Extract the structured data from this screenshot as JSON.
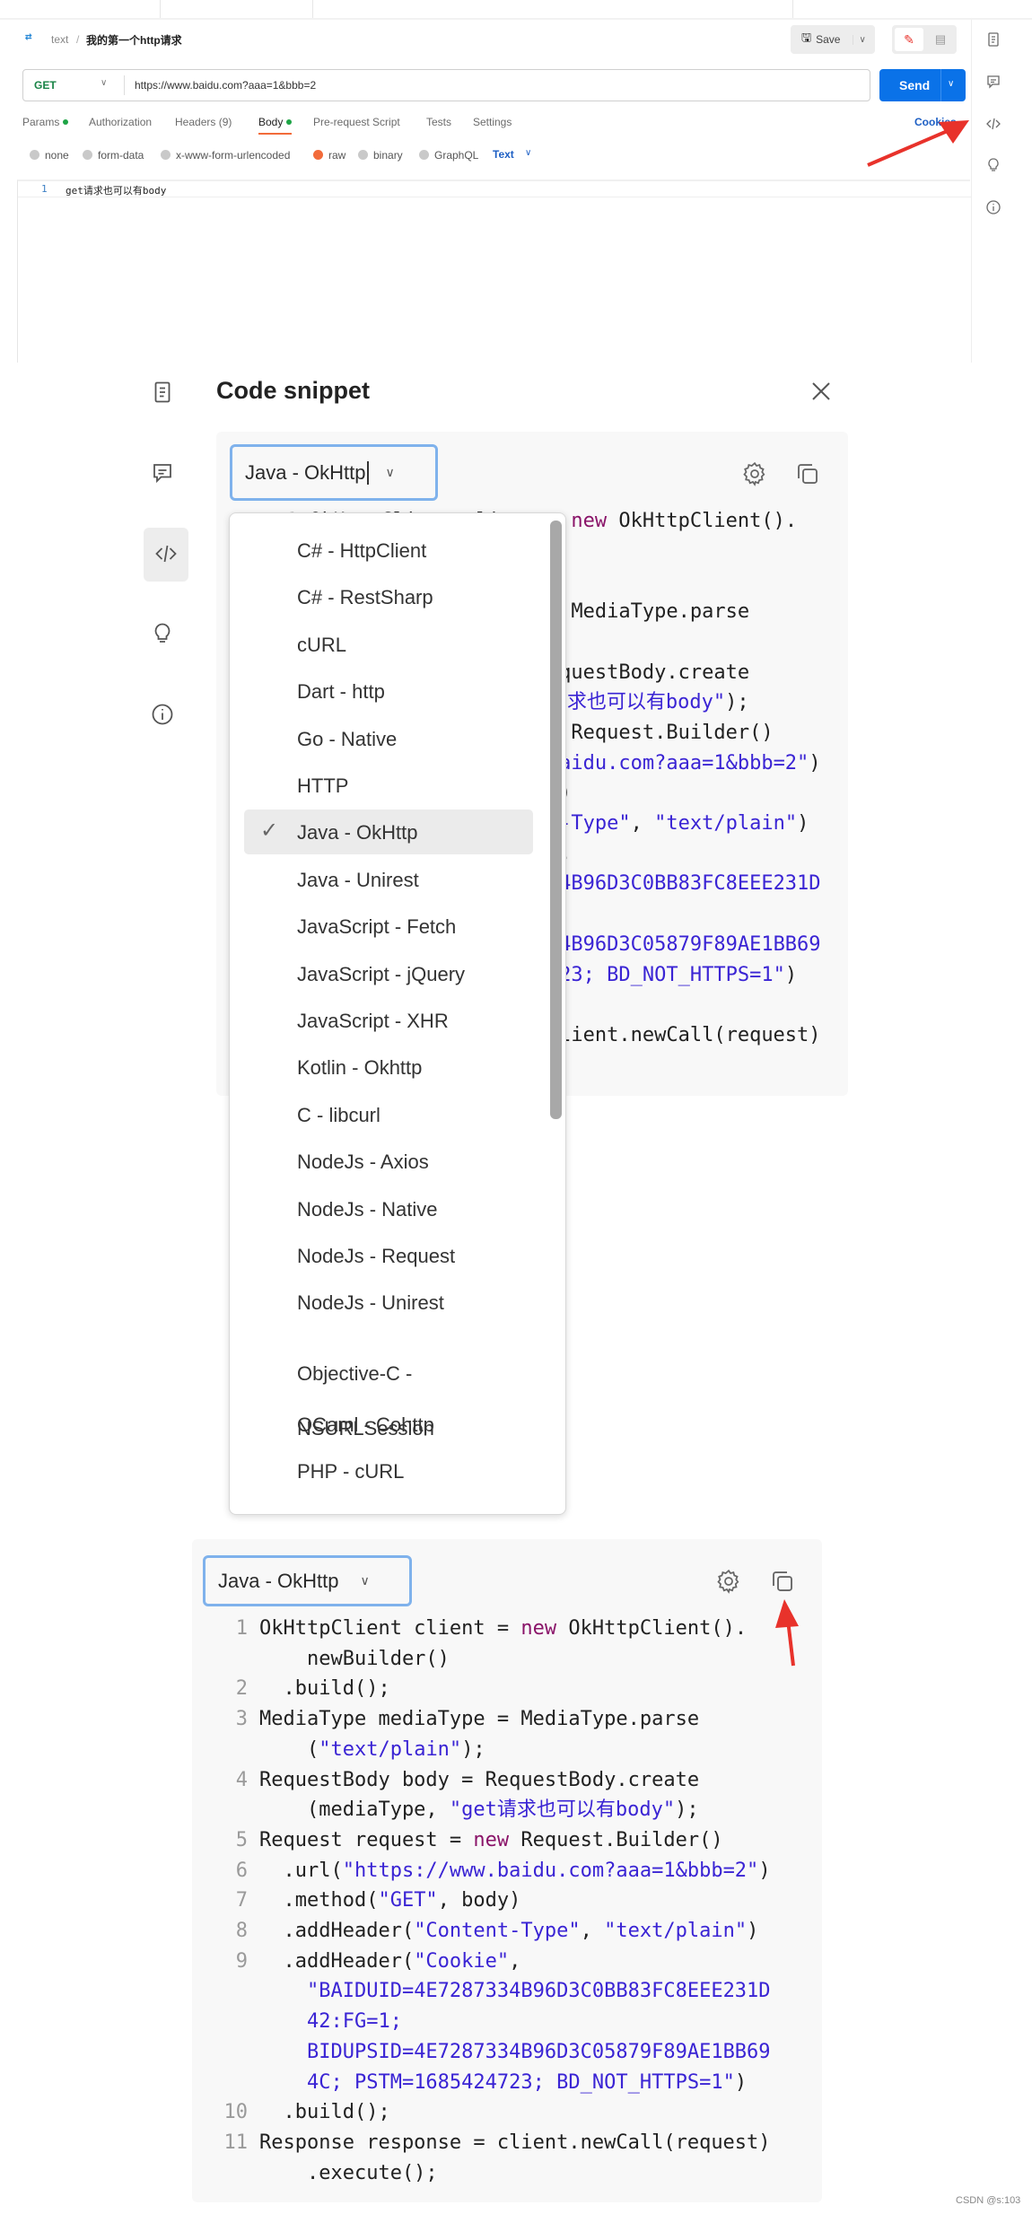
{
  "request": {
    "breadcrumb_collection": "text",
    "breadcrumb_sep": "/",
    "title": "我的第一个http请求",
    "save_label": "Save",
    "method": "GET",
    "url": "https://www.baidu.com?aaa=1&bbb=2",
    "send_label": "Send",
    "tabs": [
      {
        "label": "Params",
        "dot": true
      },
      {
        "label": "Authorization"
      },
      {
        "label": "Headers (9)"
      },
      {
        "label": "Body",
        "dot": true,
        "active": true
      },
      {
        "label": "Pre-request Script"
      },
      {
        "label": "Tests"
      },
      {
        "label": "Settings"
      }
    ],
    "cookies_label": "Cookies",
    "body_types": [
      "none",
      "form-data",
      "x-www-form-urlencoded",
      "raw",
      "binary",
      "GraphQL"
    ],
    "selected_body_type": "raw",
    "format": "Text",
    "editor_line_number": "1",
    "editor_line": "get请求也可以有body"
  },
  "snippet": {
    "title": "Code snippet",
    "selected_language": "Java - OkHttp",
    "languages": [
      "C# - HttpClient",
      "C# - RestSharp",
      "cURL",
      "Dart - http",
      "Go - Native",
      "HTTP",
      "Java - OkHttp",
      "Java - Unirest",
      "JavaScript - Fetch",
      "JavaScript - jQuery",
      "JavaScript - XHR",
      "Kotlin - Okhttp",
      "C - libcurl",
      "NodeJs - Axios",
      "NodeJs - Native",
      "NodeJs - Request",
      "NodeJs - Unirest",
      "Objective-C - NSURLSession",
      "OCaml - Cohttp",
      "PHP - cURL"
    ],
    "code_rows": [
      {
        "n": "1",
        "t": [
          [
            "OkHttpClient client = ",
            ""
          ],
          [
            "new",
            "kw"
          ],
          [
            " OkHttpClient().",
            ""
          ]
        ]
      },
      {
        "n": "",
        "t": [
          [
            "    newBuilder()",
            ""
          ]
        ]
      },
      {
        "n": "2",
        "t": [
          [
            "  .build();",
            ""
          ]
        ]
      },
      {
        "n": "3",
        "t": [
          [
            "MediaType mediaType = MediaType.parse",
            ""
          ]
        ]
      },
      {
        "n": "",
        "t": [
          [
            "    (",
            ""
          ],
          [
            "\"text/plain\"",
            "str"
          ],
          [
            ");",
            ""
          ]
        ]
      },
      {
        "n": "4",
        "t": [
          [
            "RequestBody body = RequestBody.create",
            ""
          ]
        ]
      },
      {
        "n": "",
        "t": [
          [
            "    (mediaType, ",
            ""
          ],
          [
            "\"get请求也可以有body\"",
            "str"
          ],
          [
            ");",
            ""
          ]
        ]
      },
      {
        "n": "5",
        "t": [
          [
            "Request request = ",
            ""
          ],
          [
            "new",
            "kw"
          ],
          [
            " Request.Builder()",
            ""
          ]
        ]
      },
      {
        "n": "6",
        "t": [
          [
            "  .url(",
            ""
          ],
          [
            "\"https://www.baidu.com?aaa=1&bbb=2\"",
            "str"
          ],
          [
            ")",
            ""
          ]
        ]
      },
      {
        "n": "7",
        "t": [
          [
            "  .method(",
            ""
          ],
          [
            "\"GET\"",
            "str"
          ],
          [
            ", body)",
            ""
          ]
        ]
      },
      {
        "n": "8",
        "t": [
          [
            "  .addHeader(",
            ""
          ],
          [
            "\"Content-Type\"",
            "str"
          ],
          [
            ", ",
            ""
          ],
          [
            "\"text/plain\"",
            "str"
          ],
          [
            ")",
            ""
          ]
        ]
      },
      {
        "n": "9",
        "t": [
          [
            "  .addHeader(",
            ""
          ],
          [
            "\"Cookie\"",
            "str"
          ],
          [
            ",",
            ""
          ]
        ]
      },
      {
        "n": "",
        "t": [
          [
            "    ",
            ""
          ],
          [
            "\"BAIDUID=4E7287334B96D3C0BB83FC8EEE231D",
            "str"
          ]
        ]
      },
      {
        "n": "",
        "t": [
          [
            "    ",
            ""
          ],
          [
            "42:FG=1;",
            "str"
          ]
        ]
      },
      {
        "n": "",
        "t": [
          [
            "    ",
            ""
          ],
          [
            "BIDUPSID=4E7287334B96D3C05879F89AE1BB69",
            "str"
          ]
        ]
      },
      {
        "n": "",
        "t": [
          [
            "    ",
            ""
          ],
          [
            "4C; PSTM=1685424723; BD_NOT_HTTPS=1\"",
            "str"
          ],
          [
            ")",
            ""
          ]
        ]
      },
      {
        "n": "10",
        "t": [
          [
            "  .build();",
            ""
          ]
        ]
      },
      {
        "n": "11",
        "t": [
          [
            "Response response = client.newCall(request)",
            ""
          ]
        ]
      },
      {
        "n": "",
        "t": [
          [
            "    .execute();",
            ""
          ]
        ]
      }
    ]
  },
  "watermark": "CSDN @s:103",
  "colors": {
    "accent": "#0a72e8",
    "annotation_arrow": "#e8322b",
    "keyword": "#8a1469",
    "string": "#3a24d4",
    "focus_border": "#7fb2ec"
  }
}
